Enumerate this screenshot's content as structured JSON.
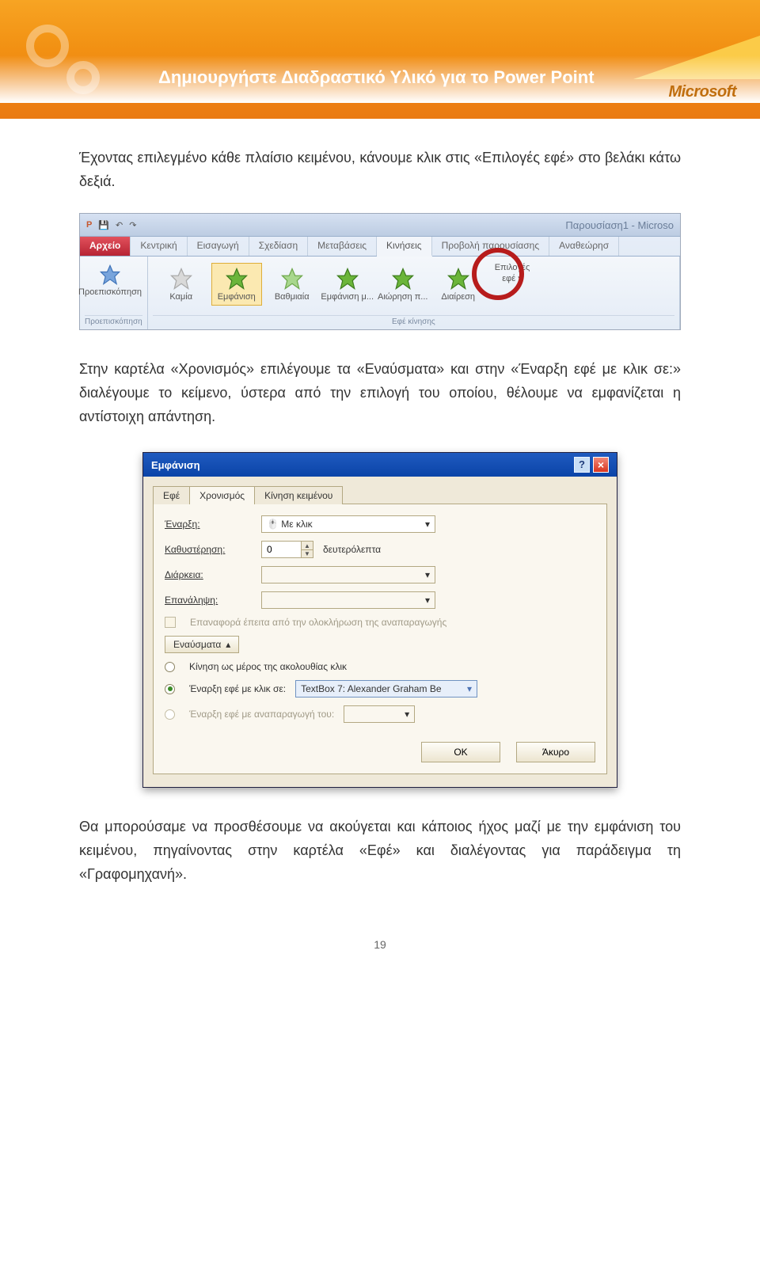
{
  "header": {
    "title": "Δημιουργήστε Διαδραστικό Υλικό για το Power Point",
    "brand": "Microsoft"
  },
  "paragraphs": {
    "p1": "Έχοντας επιλεγμένο κάθε πλαίσιο κειμένου, κάνουμε κλικ στις «Επιλογές εφέ» στο βελάκι κάτω δεξιά.",
    "p2": "Στην καρτέλα «Χρονισμός» επιλέγουμε τα «Εναύσματα» και στην «Έναρξη εφέ με κλικ σε:» διαλέγουμε το κείμενο, ύστερα από την επιλογή του οποίου, θέλουμε να εμφανίζεται η αντίστοιχη απάντηση.",
    "p3": "Θα μπορούσαμε να προσθέσουμε να ακούγεται και κάποιος ήχος μαζί με την εμφάνιση του κειμένου, πηγαίνοντας στην καρτέλα «Εφέ» και διαλέγοντας για παράδειγμα τη «Γραφομηχανή»."
  },
  "ribbon": {
    "doc_title": "Παρουσίαση1 - Microso",
    "tabs": {
      "file": "Αρχείο",
      "home": "Κεντρική",
      "insert": "Εισαγωγή",
      "design": "Σχεδίαση",
      "trans": "Μεταβάσεις",
      "anim": "Κινήσεις",
      "slideshow": "Προβολή παρουσίασης",
      "review": "Αναθεώρησ"
    },
    "groups": {
      "preview": "Προεπισκόπηση",
      "effect": "Εφέ κίνησης"
    },
    "preview_btn": "Προεπισκόπηση",
    "effects": {
      "none": "Καμία",
      "appear": "Εμφάνιση",
      "fade": "Βαθμιαία",
      "flyin": "Εμφάνιση μ...",
      "floatin": "Αιώρηση π...",
      "split": "Διαίρεση"
    },
    "options": "Επιλογές\nεφέ ▾"
  },
  "dialog": {
    "title": "Εμφάνιση",
    "tabs": {
      "effect": "Εφέ",
      "timing": "Χρονισμός",
      "text": "Κίνηση κειμένου"
    },
    "labels": {
      "start": "Έναρξη:",
      "delay": "Καθυστέρηση:",
      "dur": "Διάρκεια:",
      "repeat": "Επανάληψη:"
    },
    "start_value": "Με κλικ",
    "delay_value": "0",
    "delay_unit": "δευτερόλεπτα",
    "rewind": "Επαναφορά έπειτα από την ολοκλήρωση της αναπαραγωγής",
    "triggers_btn": "Εναύσματα",
    "opt_seq": "Κίνηση ως μέρος της ακολουθίας κλικ",
    "opt_click": "Έναρξη εφέ με κλικ σε:",
    "opt_click_val": "TextBox 7: Alexander Graham Be",
    "opt_play": "Έναρξη εφέ με αναπαραγωγή του:",
    "ok": "OK",
    "cancel": "Άκυρο"
  },
  "page_number": "19"
}
